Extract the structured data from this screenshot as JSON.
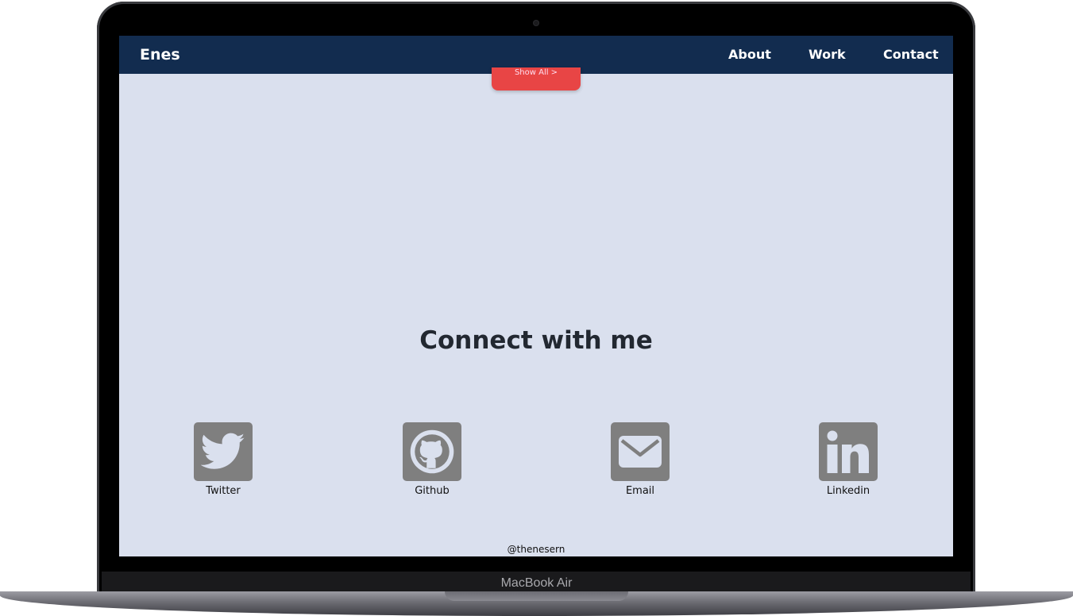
{
  "nav": {
    "brand": "Enes",
    "links": [
      "About",
      "Work",
      "Contact"
    ]
  },
  "show_all_button": "Show All >",
  "connect": {
    "heading": "Connect with me",
    "items": [
      {
        "label": "Twitter",
        "icon": "twitter-icon"
      },
      {
        "label": "Github",
        "icon": "github-icon"
      },
      {
        "label": "Email",
        "icon": "email-icon"
      },
      {
        "label": "Linkedin",
        "icon": "linkedin-icon"
      }
    ]
  },
  "footer": {
    "handle": "@thenesern"
  },
  "device": {
    "label": "MacBook Air"
  },
  "colors": {
    "navbar": "#122c4f",
    "background": "#dae0ee",
    "button": "#e84545",
    "icon_tile": "#7f7f7f"
  }
}
